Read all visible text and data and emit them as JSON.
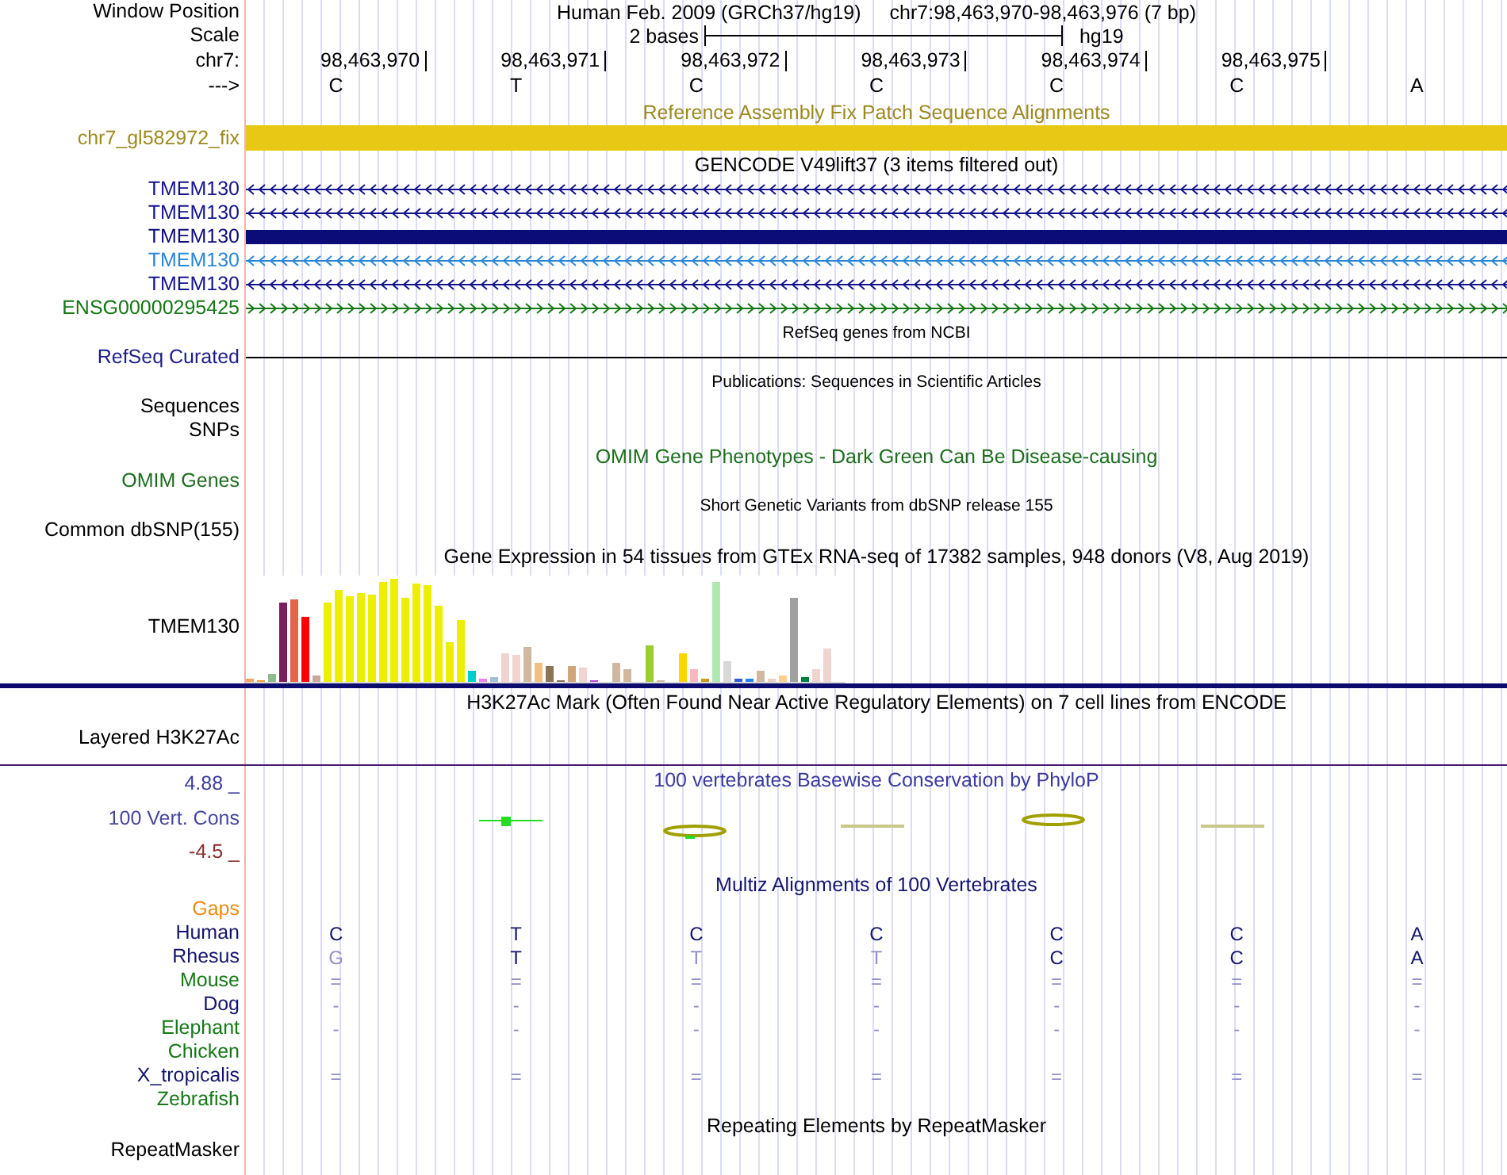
{
  "rows": [
    {
      "kind": "position",
      "label": "Window Position",
      "color": "#000000",
      "assembly": "Human Feb. 2009 (GRCh37/hg19)",
      "range": "chr7:98,463,970-98,463,976 (7 bp)"
    },
    {
      "kind": "scale",
      "label": "Scale",
      "color": "#000000",
      "scale_text": "2 bases",
      "db": "hg19"
    },
    {
      "kind": "coords",
      "label": "chr7:",
      "color": "#000000",
      "positions": [
        "98,463,970",
        "98,463,971",
        "98,463,972",
        "98,463,973",
        "98,463,974",
        "98,463,975"
      ]
    },
    {
      "kind": "bases",
      "label": "--->",
      "color": "#000000",
      "bases": [
        "C",
        "T",
        "C",
        "C",
        "C",
        "C",
        "A"
      ]
    },
    {
      "kind": "title",
      "text": "Reference Assembly Fix Patch Sequence Alignments",
      "color": "#9c8a1e"
    },
    {
      "kind": "bar",
      "label": "chr7_gl582972_fix",
      "color": "#9c8a1e"
    },
    {
      "kind": "title",
      "text": "GENCODE V49lift37 (3 items filtered out)",
      "color": "#000000"
    },
    {
      "kind": "reverse",
      "label": "TMEM130",
      "color": "#14148c"
    },
    {
      "kind": "reverse",
      "label": "TMEM130",
      "color": "#14148c"
    },
    {
      "kind": "block",
      "label": "TMEM130",
      "color": "#0c0c78"
    },
    {
      "kind": "reverse",
      "label": "TMEM130",
      "color": "#2a86d8"
    },
    {
      "kind": "reverse",
      "label": "TMEM130",
      "color": "#14148c"
    },
    {
      "kind": "forward",
      "label": "ENSG00000295425",
      "color": "#147814"
    },
    {
      "kind": "note",
      "text": "RefSeq genes from NCBI",
      "color": "#000000"
    },
    {
      "kind": "line",
      "label": "RefSeq Curated",
      "color": "#1c1c8c"
    },
    {
      "kind": "note",
      "text": "Publications: Sequences in Scientific Articles",
      "color": "#000000"
    },
    {
      "kind": "label",
      "label": "Sequences",
      "color": "#000000"
    },
    {
      "kind": "label",
      "label": "SNPs",
      "color": "#000000"
    },
    {
      "kind": "title",
      "text": "OMIM Gene Phenotypes - Dark Green Can Be Disease-causing",
      "color": "#1c6e1c"
    },
    {
      "kind": "label",
      "label": "OMIM Genes",
      "color": "#1c6e1c"
    },
    {
      "kind": "note",
      "text": "Short Genetic Variants from dbSNP release 155",
      "color": "#000000"
    },
    {
      "kind": "label",
      "label": "Common dbSNP(155)",
      "color": "#000000"
    },
    {
      "kind": "title",
      "text": "Gene Expression in 54 tissues from GTEx RNA-seq of 17382 samples, 948 donors (V8, Aug 2019)",
      "color": "#000000"
    },
    {
      "kind": "gtex",
      "label": "TMEM130",
      "color": "#000000"
    },
    {
      "kind": "title",
      "text": "H3K27Ac Mark (Often Found Near Active Regulatory Elements) on 7 cell lines from ENCODE",
      "color": "#000000"
    },
    {
      "kind": "signal",
      "label": "Layered H3K27Ac",
      "color": "#000000"
    },
    {
      "kind": "conservation",
      "text": "100 vertebrates Basewise Conservation by PhyloP",
      "color": "#3a3aa0",
      "scale_labels": [
        {
          "text": "4.88 _",
          "color": "#3c3ca0"
        },
        {
          "text": "100 Vert. Cons",
          "color": "#4646a0"
        },
        {
          "text": "-4.5 _",
          "color": "#8c2a2a"
        }
      ]
    },
    {
      "kind": "title",
      "text": "Multiz Alignments of 100 Vertebrates",
      "color": "#14146e"
    },
    {
      "kind": "label",
      "label": "Gaps",
      "color": "#f08c14"
    },
    {
      "kind": "align",
      "label": "Human",
      "color": "#14146e",
      "bases": [
        {
          "text": "C",
          "dim": false
        },
        {
          "text": "T",
          "dim": false
        },
        {
          "text": "C",
          "dim": false
        },
        {
          "text": "C",
          "dim": false
        },
        {
          "text": "C",
          "dim": false
        },
        {
          "text": "C",
          "dim": false
        },
        {
          "text": "A",
          "dim": false
        }
      ]
    },
    {
      "kind": "align",
      "label": "Rhesus",
      "color": "#14146e",
      "bases": [
        {
          "text": "G",
          "dim": true
        },
        {
          "text": "T",
          "dim": false
        },
        {
          "text": "T",
          "dim": true
        },
        {
          "text": "T",
          "dim": true
        },
        {
          "text": "C",
          "dim": false
        },
        {
          "text": "C",
          "dim": false
        },
        {
          "text": "A",
          "dim": false
        }
      ]
    },
    {
      "kind": "align",
      "label": "Mouse",
      "color": "#147814",
      "bases": [
        {
          "text": "=",
          "dim": true
        },
        {
          "text": "=",
          "dim": true
        },
        {
          "text": "=",
          "dim": true
        },
        {
          "text": "=",
          "dim": true
        },
        {
          "text": "=",
          "dim": true
        },
        {
          "text": "=",
          "dim": true
        },
        {
          "text": "=",
          "dim": true
        }
      ]
    },
    {
      "kind": "align",
      "label": "Dog",
      "color": "#14146e",
      "bases": [
        {
          "text": "-",
          "dim": true
        },
        {
          "text": "-",
          "dim": true
        },
        {
          "text": "-",
          "dim": true
        },
        {
          "text": "-",
          "dim": true
        },
        {
          "text": "-",
          "dim": true
        },
        {
          "text": "-",
          "dim": true
        },
        {
          "text": "-",
          "dim": true
        }
      ]
    },
    {
      "kind": "align",
      "label": "Elephant",
      "color": "#147814",
      "bases": [
        {
          "text": "-",
          "dim": true
        },
        {
          "text": "-",
          "dim": true
        },
        {
          "text": "-",
          "dim": true
        },
        {
          "text": "-",
          "dim": true
        },
        {
          "text": "-",
          "dim": true
        },
        {
          "text": "-",
          "dim": true
        },
        {
          "text": "-",
          "dim": true
        }
      ]
    },
    {
      "kind": "align",
      "label": "Chicken",
      "color": "#147814",
      "bases": []
    },
    {
      "kind": "align",
      "label": "X_tropicalis",
      "color": "#14146e",
      "bases": [
        {
          "text": "=",
          "dim": true
        },
        {
          "text": "=",
          "dim": true
        },
        {
          "text": "=",
          "dim": true
        },
        {
          "text": "=",
          "dim": true
        },
        {
          "text": "=",
          "dim": true
        },
        {
          "text": "=",
          "dim": true
        },
        {
          "text": "=",
          "dim": true
        }
      ]
    },
    {
      "kind": "align",
      "label": "Zebrafish",
      "color": "#147814",
      "bases": []
    },
    {
      "kind": "title",
      "text": "Repeating Elements by RepeatMasker",
      "color": "#000000"
    },
    {
      "kind": "label",
      "label": "RepeatMasker",
      "color": "#000000"
    }
  ]
}
